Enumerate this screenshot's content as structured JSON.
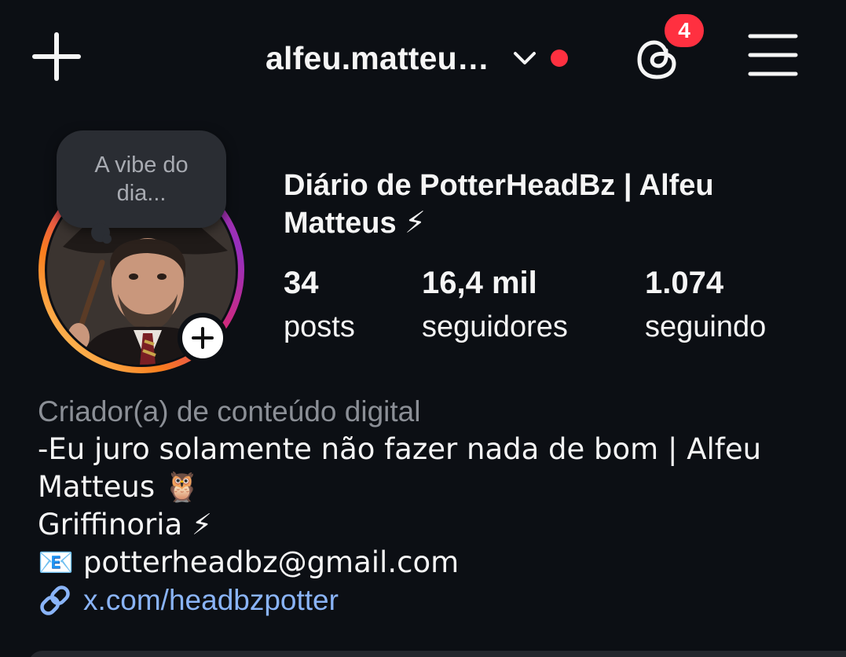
{
  "topbar": {
    "username": "alfeu.matteu…",
    "notification_count": "4"
  },
  "profile": {
    "note": "A vibe do dia...",
    "display_name": "Diário de PotterHeadBz | Alfeu Matteus ⚡",
    "stats": [
      {
        "value": "34",
        "label": "posts"
      },
      {
        "value": "16,4 mil",
        "label": "seguidores"
      },
      {
        "value": "1.074",
        "label": "seguindo"
      }
    ]
  },
  "bio": {
    "category": "Criador(a) de conteúdo digital",
    "line1": "-Eu juro solamente não fazer nada de bom | Alfeu Matteus 🦉",
    "line2": "Griffinoria ⚡",
    "line3": "📧 potterheadbz@gmail.com",
    "link": "x.com/headbzpotter"
  },
  "colors": {
    "background": "#0c0f14",
    "accent_red": "#ff3040",
    "link_blue": "#8ab4f8",
    "muted_text": "#8b8f96"
  },
  "icons": [
    "plus-icon",
    "chevron-down-icon",
    "threads-icon",
    "menu-icon",
    "link-icon"
  ]
}
